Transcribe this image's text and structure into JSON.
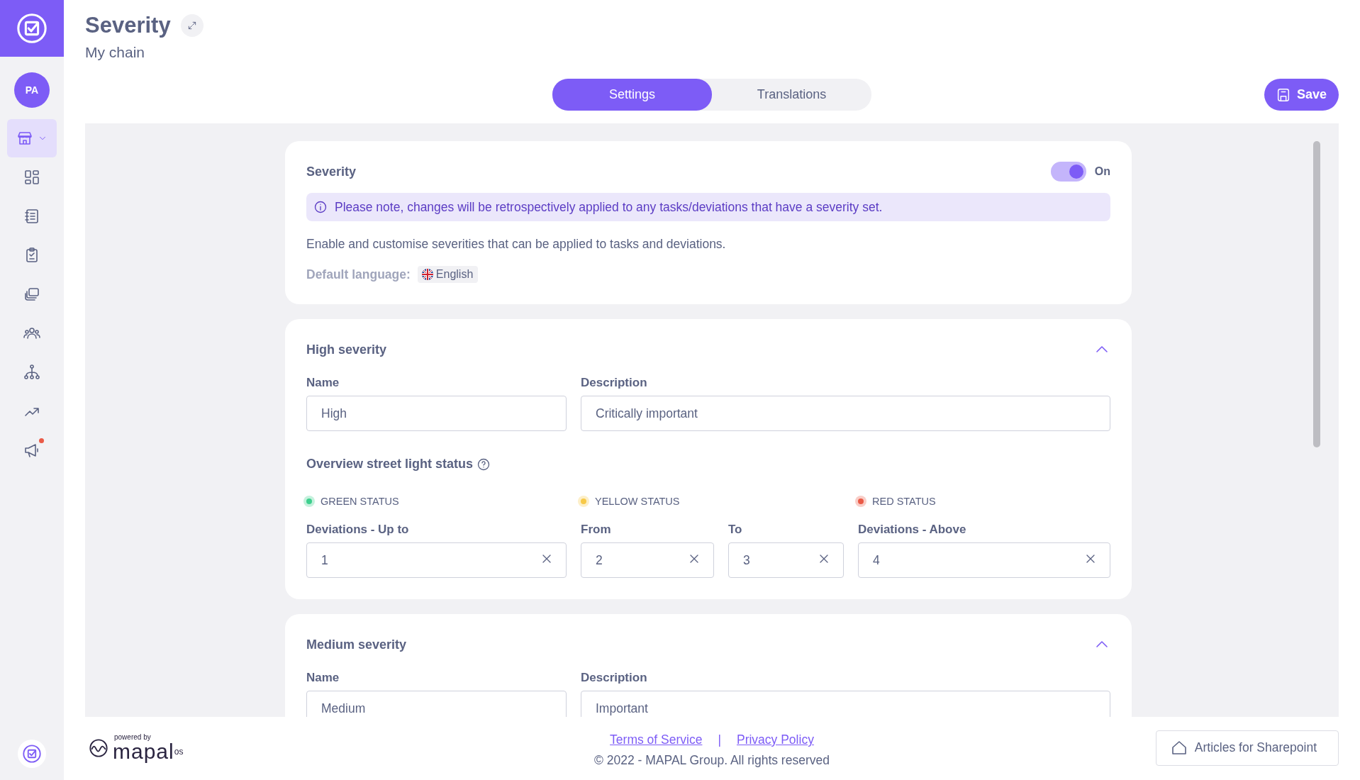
{
  "sidebar": {
    "avatar": "PA",
    "items": [
      {
        "selected": true,
        "has_menu": true,
        "badge": false
      },
      {
        "selected": false,
        "has_menu": false,
        "badge": false
      },
      {
        "selected": false,
        "has_menu": false,
        "badge": false
      },
      {
        "selected": false,
        "has_menu": false,
        "badge": false
      },
      {
        "selected": false,
        "has_menu": false,
        "badge": false
      },
      {
        "selected": false,
        "has_menu": false,
        "badge": false
      },
      {
        "selected": false,
        "has_menu": false,
        "badge": false
      },
      {
        "selected": false,
        "has_menu": false,
        "badge": false
      },
      {
        "selected": false,
        "has_menu": false,
        "badge": true
      }
    ]
  },
  "header": {
    "title": "Severity",
    "subtitle": "My chain"
  },
  "tabs": [
    {
      "label": "Settings",
      "selected": true
    },
    {
      "label": "Translations",
      "selected": false
    }
  ],
  "save_button": "Save",
  "severity_card": {
    "title": "Severity",
    "toggle": {
      "on": true,
      "label": "On"
    },
    "notice": "Please note, changes will be retrospectively applied to any tasks/deviations that have a severity set.",
    "description": "Enable and customise severities that can be applied to tasks and deviations.",
    "default_language_label": "Default language:",
    "language": "English"
  },
  "levels": [
    {
      "title": "High severity",
      "expanded": true,
      "name_label": "Name",
      "name": "High",
      "description_label": "Description",
      "description": "Critically important",
      "status_title": "Overview street light status",
      "statuses": [
        {
          "label": "GREEN STATUS",
          "color": "#3ecf8e"
        },
        {
          "label": "YELLOW STATUS",
          "color": "#f7c948"
        },
        {
          "label": "RED STATUS",
          "color": "#ea5a47"
        }
      ],
      "fields": [
        {
          "label": "Deviations - Up to",
          "value": "1"
        },
        {
          "label": "From",
          "value": "2"
        },
        {
          "label": "To",
          "value": "3"
        },
        {
          "label": "Deviations - Above",
          "value": "4"
        }
      ]
    },
    {
      "title": "Medium severity",
      "expanded": true,
      "name_label": "Name",
      "name": "Medium",
      "description_label": "Description",
      "description": "Important"
    }
  ],
  "footer": {
    "powered_by": "powered by",
    "brand": "mapal",
    "brand_suffix": "os",
    "links": [
      "Terms of Service",
      "Privacy Policy"
    ],
    "separator": "|",
    "copyright": "© 2022 - MAPAL Group. All rights reserved",
    "help_button": "Articles for Sharepoint"
  }
}
